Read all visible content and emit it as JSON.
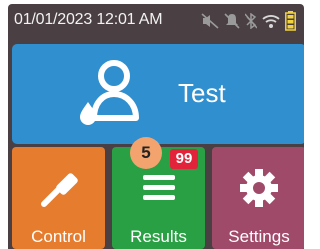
{
  "status_bar": {
    "datetime": "01/01/2023 12:01 AM",
    "icons": [
      "sound-muted-icon",
      "alerts-muted-icon",
      "bluetooth-off-icon",
      "wifi-icon",
      "battery-icon"
    ]
  },
  "tiles": {
    "test": {
      "label": "Test",
      "icon": "user-test-icon"
    },
    "control": {
      "label": "Control",
      "icon": "dropper-icon"
    },
    "results": {
      "label": "Results",
      "icon": "list-icon",
      "badge_count": "99"
    },
    "settings": {
      "label": "Settings",
      "icon": "gear-icon"
    }
  },
  "annotation_marker": "5",
  "colors": {
    "background": "#4a3f42",
    "test": "#2f8fcf",
    "control": "#e67c2e",
    "results": "#2aa044",
    "settings": "#a04a6a",
    "badge": "#e2233a"
  }
}
